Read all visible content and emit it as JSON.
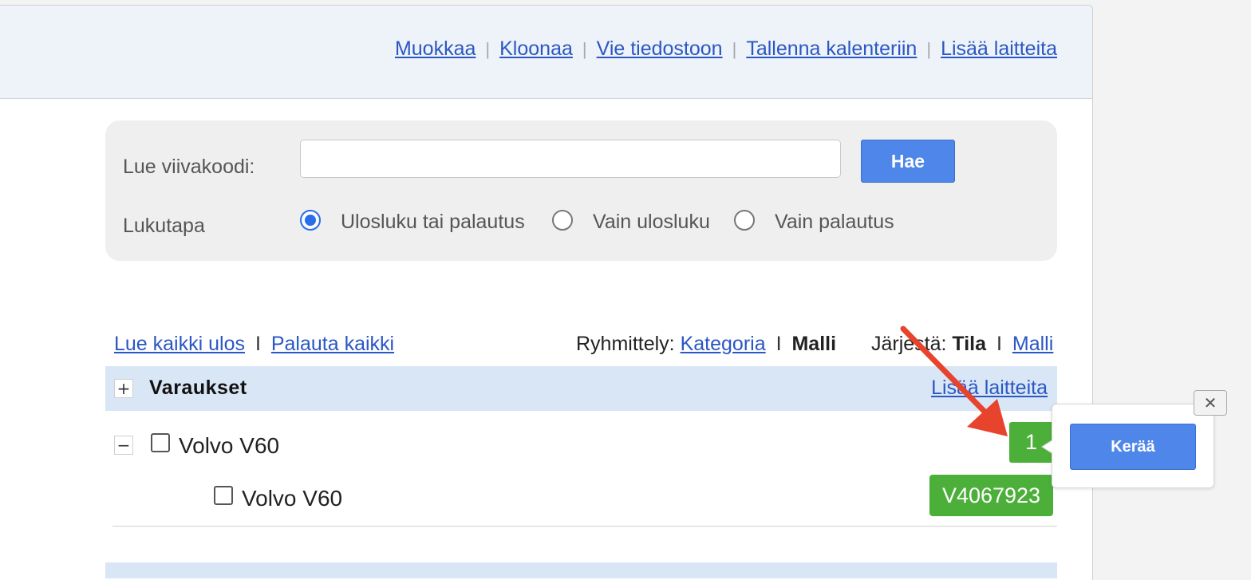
{
  "top_links": [
    "Muokkaa",
    "Kloonaa",
    "Vie tiedostoon",
    "Tallenna kalenteriin",
    "Lisää laitteita"
  ],
  "scan": {
    "barcode_label": "Lue viivakoodi:",
    "barcode_value": "",
    "search_label": "Hae",
    "mode_label": "Lukutapa",
    "modes": [
      {
        "label": "Ulosluku tai palautus",
        "checked": true
      },
      {
        "label": "Vain ulosluku",
        "checked": false
      },
      {
        "label": "Vain palautus",
        "checked": false
      }
    ]
  },
  "actions": {
    "checkout_all": "Lue kaikki ulos",
    "return_all": "Palauta kaikki"
  },
  "grouping": {
    "label": "Ryhmittely:",
    "category": "Kategoria",
    "model_active": "Malli",
    "sort_label": "Järjestä:",
    "sort_active": "Tila",
    "sort_model": "Malli"
  },
  "group": {
    "expand_symbol": "+",
    "title": "Varaukset",
    "add_link": "Lisää laitteita"
  },
  "model_row": {
    "collapse_symbol": "−",
    "name": "Volvo V60",
    "count": "1"
  },
  "item_row": {
    "name": "Volvo V60",
    "code": "V4067923"
  },
  "popup": {
    "collect_label": "Kerää",
    "close_symbol": "✕"
  },
  "colors": {
    "accent_blue": "#4f86ea",
    "badge_green": "#4caf3a",
    "annotation_arrow": "#e8432c"
  }
}
